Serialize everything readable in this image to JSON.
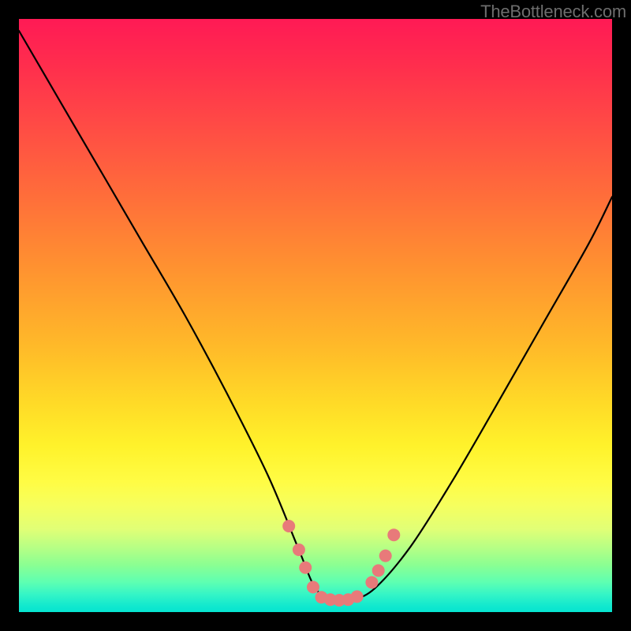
{
  "watermark": "TheBottleneck.com",
  "chart_data": {
    "type": "line",
    "title": "",
    "xlabel": "",
    "ylabel": "",
    "xlim": [
      0,
      100
    ],
    "ylim": [
      0,
      100
    ],
    "series": [
      {
        "name": "bottleneck-curve",
        "x": [
          0,
          7,
          14,
          21,
          28,
          35,
          42,
          47,
          50,
          53,
          56,
          60,
          66,
          73,
          80,
          88,
          96,
          100
        ],
        "values": [
          98,
          86,
          74,
          62,
          50,
          37,
          23,
          11,
          4,
          2,
          2,
          4,
          11,
          22,
          34,
          48,
          62,
          70
        ]
      }
    ],
    "markers": {
      "name": "highlight-dots",
      "color": "#e87a7a",
      "points": [
        {
          "x": 45.5,
          "y": 14.5
        },
        {
          "x": 47.2,
          "y": 10.5
        },
        {
          "x": 48.3,
          "y": 7.5
        },
        {
          "x": 49.6,
          "y": 4.2
        },
        {
          "x": 51.0,
          "y": 2.5
        },
        {
          "x": 52.5,
          "y": 2.1
        },
        {
          "x": 54.0,
          "y": 2.0
        },
        {
          "x": 55.5,
          "y": 2.1
        },
        {
          "x": 57.0,
          "y": 2.6
        },
        {
          "x": 59.5,
          "y": 5.0
        },
        {
          "x": 60.6,
          "y": 7.0
        },
        {
          "x": 61.8,
          "y": 9.5
        },
        {
          "x": 63.2,
          "y": 13.0
        }
      ]
    },
    "background_gradient": {
      "direction": "top-to-bottom",
      "stops": [
        "#ff1a55",
        "#ff9230",
        "#fff22b",
        "#06e4d0"
      ]
    }
  }
}
